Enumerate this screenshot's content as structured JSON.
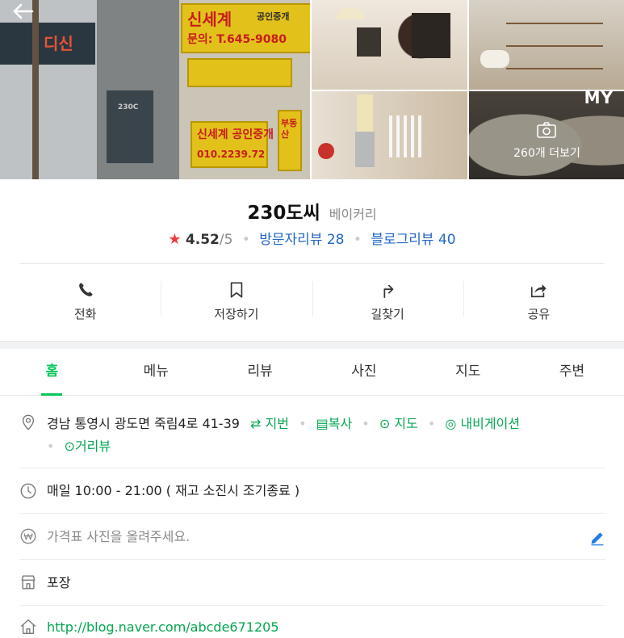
{
  "nav": {
    "back_icon": "back-arrow-icon",
    "my_label": "MY"
  },
  "photos": {
    "more_label": "260개 더보기",
    "camera_icon": "camera-icon"
  },
  "storefront_signs": {
    "a": "신세계",
    "b": "공인중개",
    "c": "문의: T.645-9080",
    "d": "신세계 공인중개",
    "e": "010.2239.72",
    "f": "부동산",
    "g": "디신",
    "h": "230C"
  },
  "place": {
    "name": "230도씨",
    "category": "베이커리",
    "rating": "4.52",
    "rating_max": "/5",
    "visitor_reviews": "방문자리뷰 28",
    "blog_reviews": "블로그리뷰 40"
  },
  "actions": [
    {
      "label": "전화",
      "icon": "phone-icon"
    },
    {
      "label": "저장하기",
      "icon": "bookmark-icon"
    },
    {
      "label": "길찾기",
      "icon": "directions-icon"
    },
    {
      "label": "공유",
      "icon": "share-icon"
    }
  ],
  "tabs": [
    "홈",
    "메뉴",
    "리뷰",
    "사진",
    "지도",
    "주변"
  ],
  "active_tab": "홈",
  "info": {
    "address": "경남 통영시 광도면 죽림4로 41-39",
    "address_links": {
      "lot": "지번",
      "copy": "복사",
      "map": "지도",
      "navi": "내비게이션",
      "street": "거리뷰"
    },
    "hours": "매일 10:00 - 21:00 ( 재고 소진시 조기종료 )",
    "price_placeholder": "가격표 사진을 올려주세요.",
    "service": "포장",
    "homepage": "http://blog.naver.com/abcde671205"
  },
  "colors": {
    "accent_green": "#03c75a",
    "link_blue": "#2267c9",
    "star_red": "#ef3b3b"
  }
}
